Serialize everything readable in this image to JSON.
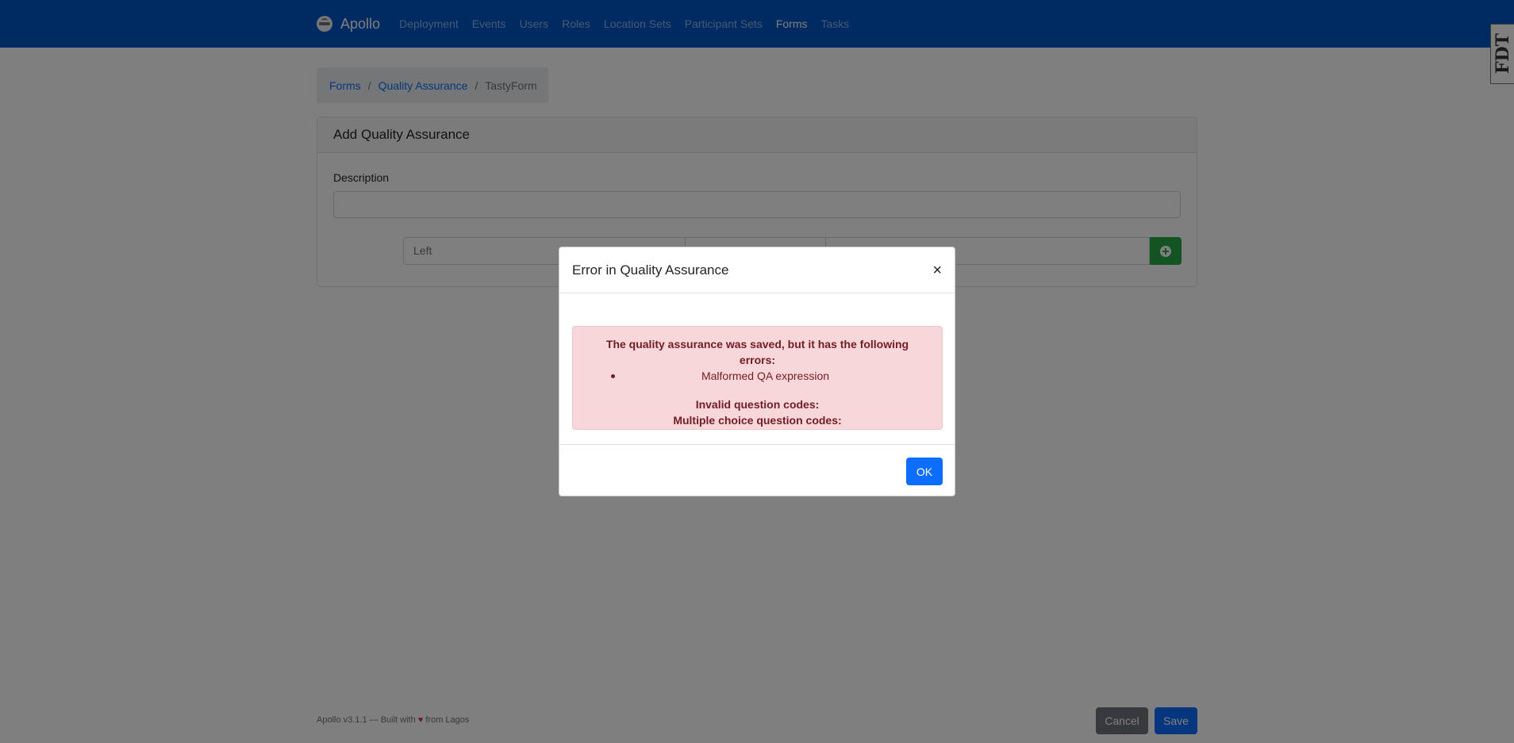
{
  "navbar": {
    "brand": "Apollo",
    "items": [
      {
        "label": "Deployment",
        "active": false
      },
      {
        "label": "Events",
        "active": false
      },
      {
        "label": "Users",
        "active": false
      },
      {
        "label": "Roles",
        "active": false
      },
      {
        "label": "Location Sets",
        "active": false
      },
      {
        "label": "Participant Sets",
        "active": false
      },
      {
        "label": "Forms",
        "active": true
      },
      {
        "label": "Tasks",
        "active": false
      }
    ],
    "fdt_tab": "FDT"
  },
  "breadcrumb": {
    "items": [
      "Forms",
      "Quality Assurance"
    ],
    "current": "TastyForm"
  },
  "card": {
    "title": "Add Quality Assurance",
    "description_label": "Description",
    "description_value": "",
    "left_placeholder": "Left"
  },
  "footer": {
    "version": "Apollo v3.1.1 — Built with",
    "heart": "♥",
    "from": "from Lagos",
    "cancel_label": "Cancel",
    "save_label": "Save"
  },
  "modal": {
    "title": "Error in Quality Assurance",
    "close": "×",
    "alert_title": "The quality assurance was saved, but it has the following errors:",
    "errors": [
      "Malformed QA expression"
    ],
    "invalid_codes_label": "Invalid question codes:",
    "multiple_choice_label": "Multiple choice question codes:",
    "ok_label": "OK"
  },
  "colors": {
    "navbar": "#0054c4",
    "primary": "#0d6efd",
    "success": "#28a745",
    "danger_bg": "#f8d7da",
    "danger_text": "#721c24"
  }
}
